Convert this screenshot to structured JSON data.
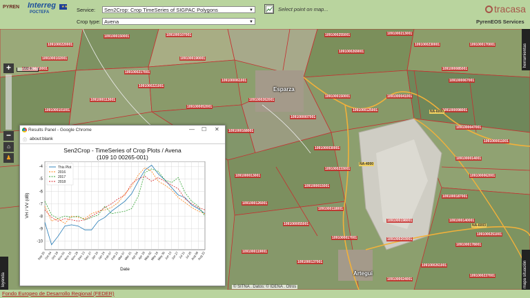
{
  "header": {
    "logo_pyren": "PYREN",
    "logo_interreg": "Interreg",
    "logo_poctefa": "POCTEFA",
    "service_label": "Service:",
    "service_value": "Sen2Crop: Crop TimeSeries of SIGPAC Polygons",
    "croptype_label": "Crop type:",
    "croptype_value": "Avena",
    "select_point_text": "Select point on map...",
    "brand": "tracasa",
    "services": "PyrenEOS Services"
  },
  "map": {
    "scale_label": "200 m",
    "right_tab": "herramientas",
    "right_tab_bottom": "mapa situación",
    "left_tab": "leyenda",
    "towns": [
      "Esparza",
      "Artegui"
    ],
    "plot_ids": [
      "1091000220001",
      "1091000150001",
      "1091000107001",
      "1091000255001",
      "1091000213001",
      "1091000230001",
      "1091000170001",
      "1091000102001",
      "1091000190001",
      "1091000269001",
      "1091000110001",
      "1091000217001",
      "1091000085001",
      "1091000221001",
      "1091000061001",
      "1091000041001",
      "1091000067001",
      "1091000150001",
      "1091000113001",
      "1091000052001",
      "1091000262001",
      "1091000125001",
      "1091000098001",
      "1091000101001",
      "1091000007001",
      "1091000047001",
      "1091000168001",
      "1091000011001",
      "1091000030001",
      "1091000014001",
      "1091000233001",
      "1091000013001",
      "1091000062001",
      "1091000015001",
      "1091000187001",
      "1091000126001",
      "1091000118001",
      "1091000198001",
      "1091000140001",
      "1091000055001",
      "1091000251001",
      "1091000017001",
      "1091000203001",
      "1091000178001",
      "1091000119001",
      "1091000137001",
      "1091000261001",
      "1091000024001",
      "1091000237001"
    ],
    "road_labels": [
      "NA-6000",
      "NA-4000",
      "NA-6003"
    ],
    "attribution": "© SITNA . Datos: © IDENA . Otros"
  },
  "popup": {
    "window_title": "Results Panel - Google Chrome",
    "url": "about:blank",
    "title_line1": "Sen2Crop - TimeSeries of Crop Plots / Avena",
    "title_line2": "(109 10 00265-001)"
  },
  "chart_data": {
    "type": "line",
    "title": "Sen2Crop - TimeSeries of Crop Plots / Avena (109 10 00265-001)",
    "xlabel": "Date",
    "ylabel": "VH / VV (dB)",
    "ylim": [
      -10.7,
      -3.6
    ],
    "yticks": [
      -4,
      -5,
      -6,
      -7,
      -8,
      -9,
      -10
    ],
    "categories": [
      "Sep 20",
      "Oct 04",
      "Oct 18",
      "Nov 01",
      "Nov 15",
      "Nov 29",
      "Dec 13",
      "Dec 27",
      "Jan 10",
      "Jan 24",
      "Feb 07",
      "Feb 21",
      "Mar 07",
      "Mar 21",
      "Apr 04",
      "Apr 18",
      "May 02",
      "May 16",
      "May 30",
      "Jun 13",
      "Jun 27",
      "Jul 11",
      "Jul 25",
      "Aug 08",
      "Aug 22"
    ],
    "grid": true,
    "legend": "top-left",
    "series": [
      {
        "name": "This Plot",
        "color": "#1f77b4",
        "dash": "",
        "values": [
          -8.5,
          -10.3,
          -9.6,
          -8.8,
          -8.7,
          -8.8,
          -9.1,
          -9.1,
          -8.4,
          -8.1,
          -7.6,
          -7.2,
          -6.8,
          -6.2,
          -5.2,
          -4.3,
          -3.9,
          -4.6,
          -5.1,
          -5.7,
          -6.3,
          -6.5,
          -7.1,
          -7.4,
          -7.8
        ]
      },
      {
        "name": "2016",
        "color": "#ff7f0e",
        "dash": "2,1.5",
        "values": [
          -7.2,
          -8.4,
          -8.2,
          -8.6,
          -8.0,
          -8.1,
          -8.2,
          -7.8,
          -7.6,
          -7.5,
          -7.3,
          -6.9,
          -6.2,
          -5.6,
          -4.7,
          -4.1,
          -4.4,
          -5.2,
          -5.5,
          -5.9,
          -6.5,
          -6.9,
          -7.3,
          -7.6,
          -7.8
        ]
      },
      {
        "name": "2017",
        "color": "#2ca02c",
        "dash": "2,1.5",
        "values": [
          -6.8,
          -7.9,
          -8.2,
          -8.0,
          -8.1,
          -8.0,
          -8.3,
          -8.1,
          -7.9,
          -7.2,
          -7.8,
          -7.7,
          -7.6,
          -7.4,
          -6.4,
          -4.5,
          -4.2,
          -4.4,
          -5.1,
          -5.3,
          -4.9,
          -6.1,
          -6.8,
          -7.2,
          -8.0
        ]
      },
      {
        "name": "2018",
        "color": "#d62728",
        "dash": "2,1.5",
        "values": [
          -7.5,
          -8.1,
          -8.4,
          -8.2,
          -8.3,
          -8.4,
          -8.3,
          -8.0,
          -7.7,
          -7.3,
          -7.0,
          -6.6,
          -6.3,
          -5.4,
          -5.0,
          -4.8,
          -5.2,
          -4.9,
          -5.2,
          -5.5,
          -5.8,
          -6.6,
          -7.0,
          -7.3,
          -7.5
        ]
      }
    ]
  }
}
